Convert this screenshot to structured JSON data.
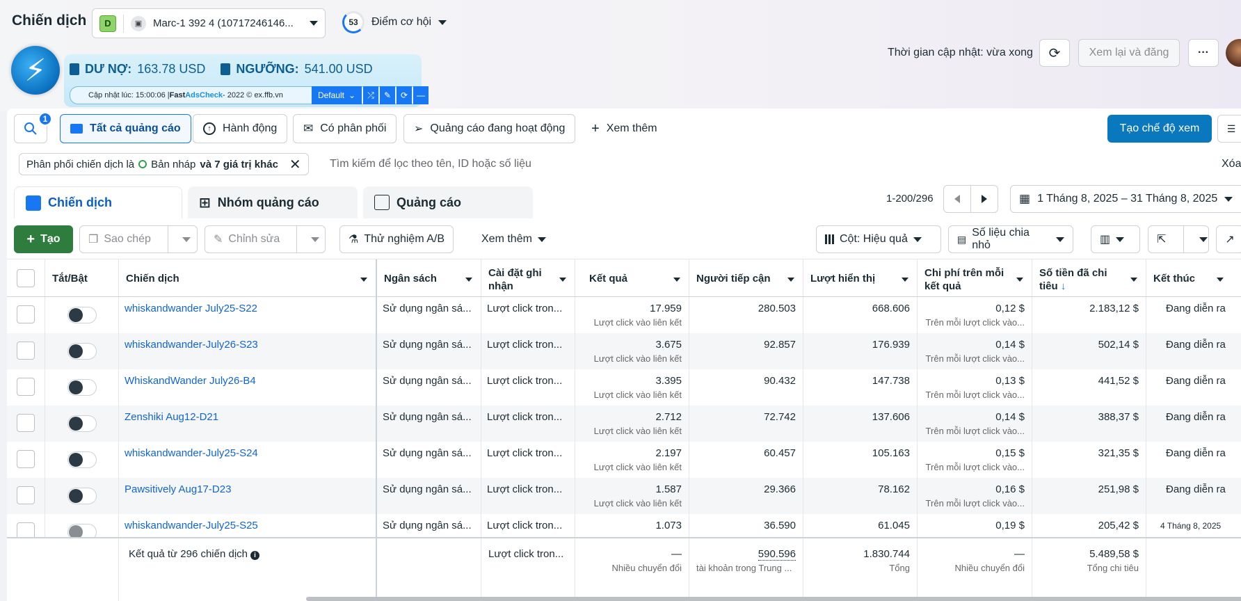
{
  "header": {
    "title": "Chiến dịch",
    "account": {
      "badge": "D",
      "icon": "ad-account-icon",
      "name": "Marc-1 392 4 (10717246146..."
    },
    "score": {
      "value": "53",
      "label": "Điểm cơ hội"
    },
    "update_text": "Thời gian cập nhật: vừa xong",
    "refresh_icon": "refresh-icon",
    "review_publish": "Xem lại và đăng",
    "more": "···"
  },
  "extension": {
    "debt_label": "DƯ NỢ:",
    "debt_value": "163.78 USD",
    "threshold_label": "NGƯỠNG:",
    "threshold_value": "541.00 USD",
    "updated": "Cập nhật lúc: 15:00:06 | ",
    "brand": "Fast ",
    "brand2": "AdsCheck",
    "copyright": " - 2022 © ex.ffb.vn",
    "profile": "Default",
    "buttons": [
      "⤮",
      "✎",
      "⟳",
      "—"
    ]
  },
  "filters": {
    "search_badge": "1",
    "all_ads": "Tất cả quảng cáo",
    "activity": "Hành động",
    "has_delivery": "Có phân phối",
    "active_ads": "Quảng cáo đang hoạt động",
    "see_more": "Xem thêm",
    "create_view": "Tạo chế độ xem",
    "chip_prefix": "Phân phối chiến dịch là",
    "chip_value": "Bản nháp",
    "chip_more": "và 7 giá trị khác",
    "search_placeholder": "Tìm kiếm để lọc theo tên, ID hoặc số liệu",
    "clear": "Xóa"
  },
  "tabs": [
    "Chiến dịch",
    "Nhóm quảng cáo",
    "Quảng cáo"
  ],
  "pager": {
    "range": "1-200/296"
  },
  "date_range": "1 Tháng 8, 2025 – 31 Tháng 8, 2025",
  "toolbar": {
    "create": "Tạo",
    "copy": "Sao chép",
    "edit": "Chỉnh sửa",
    "ab_test": "Thử nghiệm A/B",
    "see_more": "Xem thêm",
    "columns": "Cột: Hiệu quả",
    "breakdown": "Số liệu chia nhỏ"
  },
  "table": {
    "headers": {
      "toggle": "Tắt/Bật",
      "campaign": "Chiến dịch",
      "budget": "Ngân sách",
      "attribution": "Cài đặt ghi nhận",
      "results": "Kết quả",
      "reach": "Người tiếp cận",
      "impressions": "Lượt hiển thị",
      "cost_per_result": "Chi phí trên mỗi kết quả",
      "amount_spent": "Số tiền đã chi tiêu",
      "sort_arrow": "↓",
      "ends": "Kết thúc"
    },
    "rows": [
      {
        "name": "whiskandwander July25-S22",
        "on": true,
        "budget": "Sử dụng ngân sá...",
        "attribution": "Lượt click tron...",
        "results": "17.959",
        "results_sub": "Lượt click vào liên kết",
        "reach": "280.503",
        "impressions": "668.606",
        "cpr": "0,12 $",
        "cpr_sub": "Trên mỗi lượt click vào...",
        "spent": "2.183,12 $",
        "ends": "Đang diễn ra"
      },
      {
        "name": "whiskandwander-July26-S23",
        "on": true,
        "budget": "Sử dụng ngân sá...",
        "attribution": "Lượt click tron...",
        "results": "3.675",
        "results_sub": "Lượt click vào liên kết",
        "reach": "92.857",
        "impressions": "176.939",
        "cpr": "0,14 $",
        "cpr_sub": "Trên mỗi lượt click vào...",
        "spent": "502,14 $",
        "ends": "Đang diễn ra"
      },
      {
        "name": "WhiskandWander July26-B4",
        "on": true,
        "budget": "Sử dụng ngân sá...",
        "attribution": "Lượt click tron...",
        "results": "3.395",
        "results_sub": "Lượt click vào liên kết",
        "reach": "90.432",
        "impressions": "147.738",
        "cpr": "0,13 $",
        "cpr_sub": "Trên mỗi lượt click vào...",
        "spent": "441,52 $",
        "ends": "Đang diễn ra"
      },
      {
        "name": "Zenshiki Aug12-D21",
        "on": true,
        "budget": "Sử dụng ngân sá...",
        "attribution": "Lượt click tron...",
        "results": "2.712",
        "results_sub": "Lượt click vào liên kết",
        "reach": "72.742",
        "impressions": "137.606",
        "cpr": "0,14 $",
        "cpr_sub": "Trên mỗi lượt click vào...",
        "spent": "388,37 $",
        "ends": "Đang diễn ra"
      },
      {
        "name": "whiskandwander-July25-S24",
        "on": true,
        "budget": "Sử dụng ngân sá...",
        "attribution": "Lượt click tron...",
        "results": "2.197",
        "results_sub": "Lượt click vào liên kết",
        "reach": "60.457",
        "impressions": "105.163",
        "cpr": "0,15 $",
        "cpr_sub": "Trên mỗi lượt click vào...",
        "spent": "321,35 $",
        "ends": "Đang diễn ra"
      },
      {
        "name": "Pawsitively Aug17-D23",
        "on": true,
        "budget": "Sử dụng ngân sá...",
        "attribution": "Lượt click tron...",
        "results": "1.587",
        "results_sub": "Lượt click vào liên kết",
        "reach": "29.366",
        "impressions": "78.162",
        "cpr": "0,16 $",
        "cpr_sub": "Trên mỗi lượt click vào...",
        "spent": "251,98 $",
        "ends": "Đang diễn ra"
      },
      {
        "name": "whiskandwander-July25-S25",
        "on": false,
        "budget": "Sử dụng ngân sá...",
        "attribution": "Lượt click tron...",
        "results": "1.073",
        "results_sub": "",
        "reach": "36.590",
        "impressions": "61.045",
        "cpr": "0,19 $",
        "cpr_sub": "",
        "spent": "205,42 $",
        "ends": "4 Tháng 8, 2025"
      }
    ],
    "footer": {
      "label": "Kết quả từ 296 chiến dịch",
      "info": "i",
      "attribution": "Lượt click tron...",
      "results": "—",
      "results_sub": "Nhiều chuyển đổi",
      "reach": "590.596",
      "reach_sub": "tài khoản trong Trung ...",
      "impressions": "1.830.744",
      "impressions_sub": "Tổng",
      "cpr": "—",
      "cpr_sub": "Nhiều chuyển đổi",
      "spent": "5.489,58 $",
      "spent_sub": "Tổng chi tiêu"
    }
  },
  "colors": {
    "primary": "#0a78be",
    "create": "#2e7d3e",
    "link": "#1164d1"
  }
}
